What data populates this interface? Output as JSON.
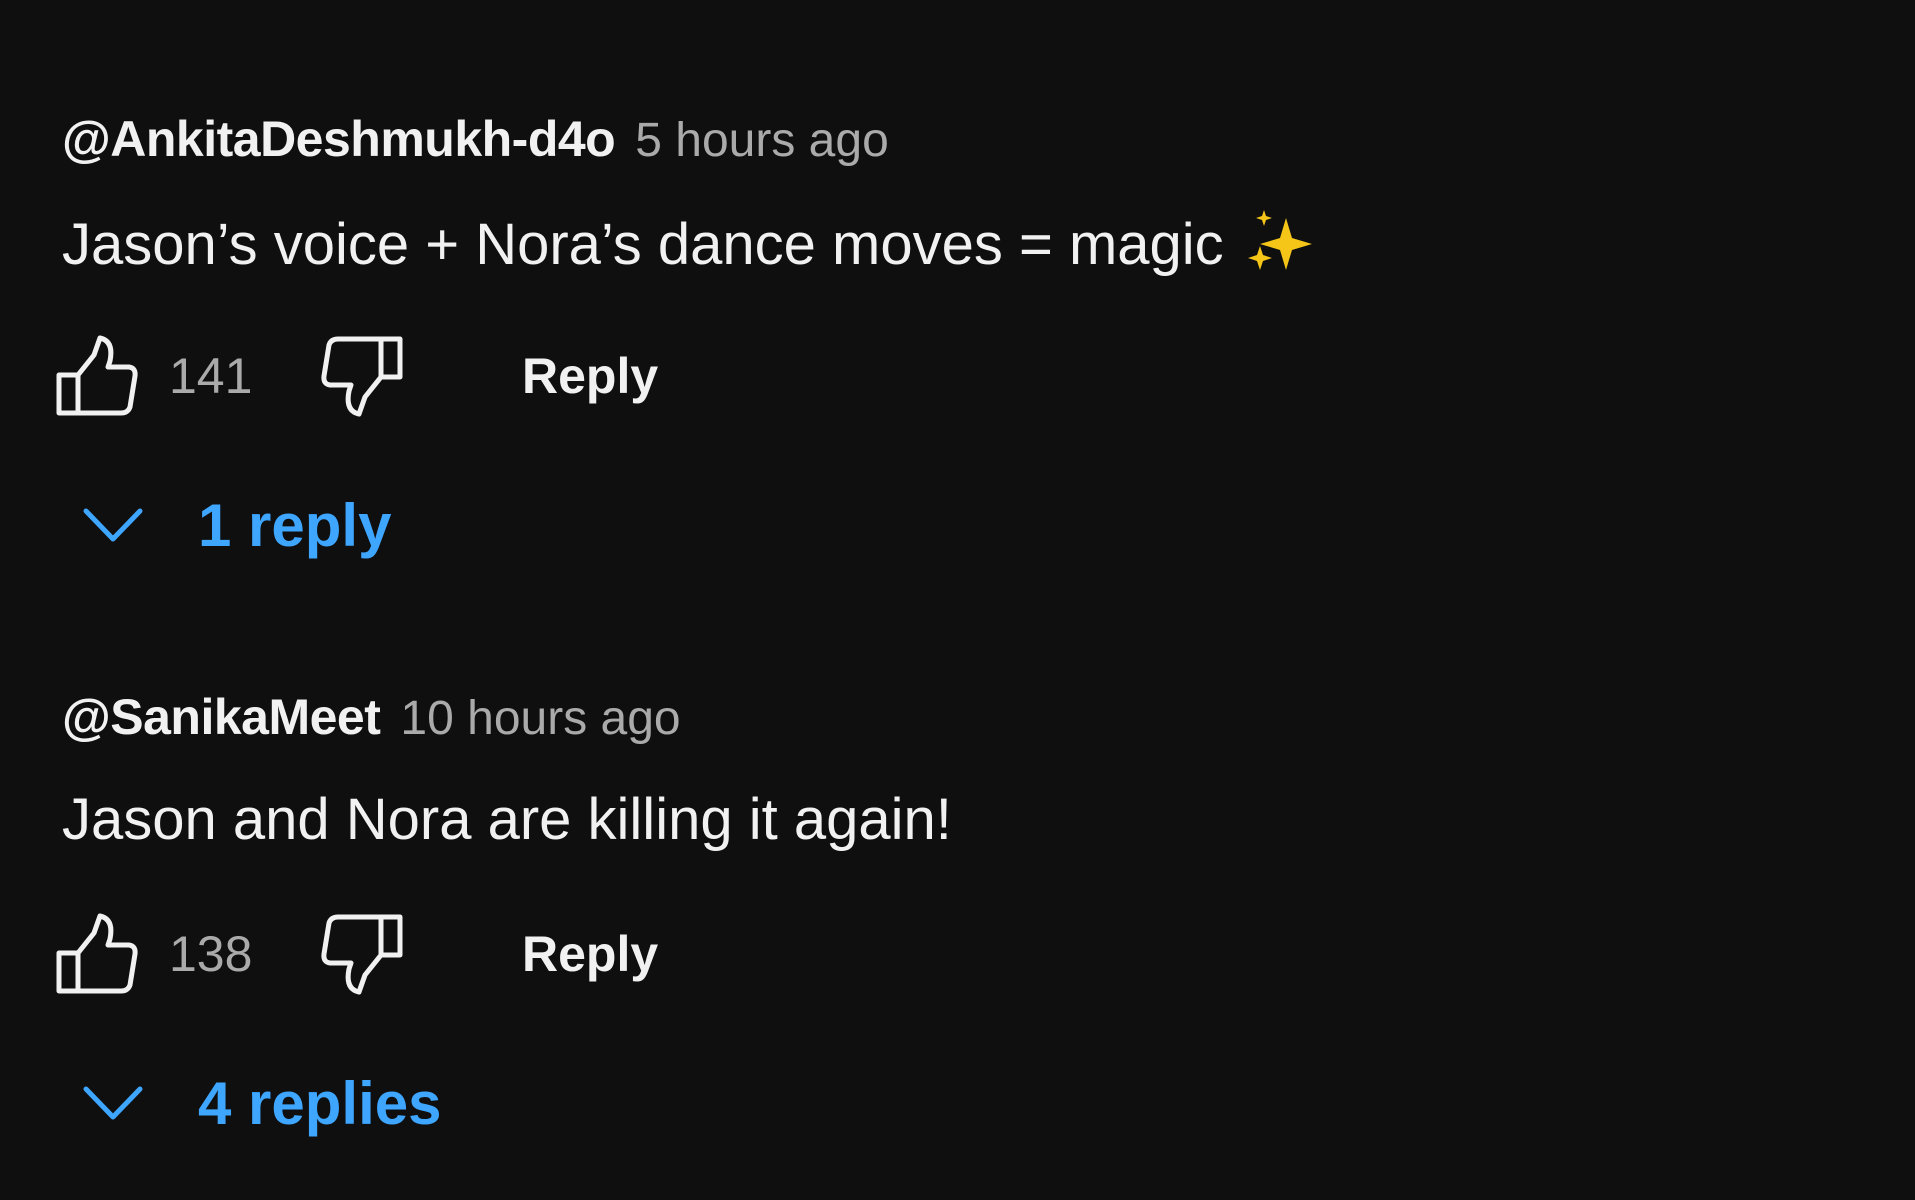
{
  "comments": [
    {
      "author": "@AnkitaDeshmukh-d4o",
      "time": "5 hours ago",
      "text": "Jason’s voice + Nora’s dance moves = magic",
      "emoji": "sparkles-emoji",
      "likes": "141",
      "reply_label": "Reply",
      "replies_label": "1 reply"
    },
    {
      "author": "@SanikaMeet",
      "time": "10 hours ago",
      "text": "Jason and Nora are killing it again!",
      "likes": "138",
      "reply_label": "Reply",
      "replies_label": "4 replies"
    }
  ],
  "colors": {
    "background": "#0f0f10",
    "primary_text": "#f1f1f1",
    "secondary_text": "#aaaaaa",
    "link_blue": "#3ea6ff",
    "sparkle_yellow": "#f5c518"
  },
  "icons": [
    "thumbs-up-icon",
    "thumbs-down-icon",
    "chevron-down-icon",
    "sparkles-emoji"
  ]
}
